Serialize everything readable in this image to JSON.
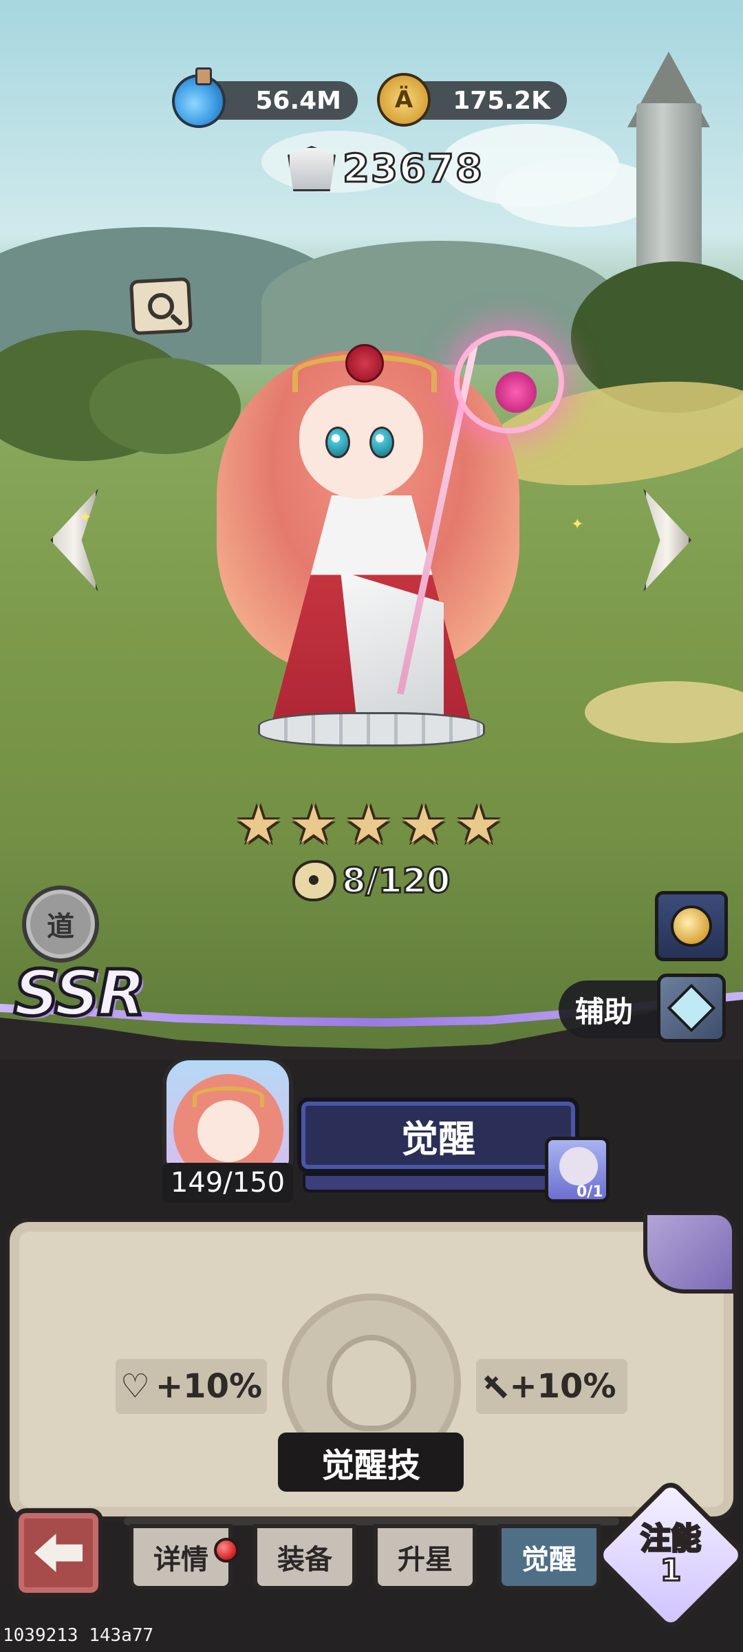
{
  "resources": {
    "potion": {
      "value": "56.4M",
      "icon": "potion-icon"
    },
    "coin": {
      "value": "175.2K",
      "icon": "coin-icon",
      "glyph": "Ä"
    }
  },
  "power": {
    "value": "23678",
    "icon": "power-shield-icon"
  },
  "hero": {
    "stars": 5,
    "star_glyph": "★",
    "shards": "8/120",
    "rarity": "SSR",
    "role": "辅助",
    "dao_label": "道"
  },
  "awaken": {
    "level": "149/150",
    "button_label": "觉醒",
    "requirement_count": "0/1",
    "stat_hp": "+10%",
    "stat_atk": "+10%",
    "skill_label": "觉醒技",
    "heart_glyph": "♡",
    "sword_glyph": "†"
  },
  "tabs": [
    {
      "label": "详情",
      "active": false
    },
    {
      "label": "装备",
      "active": false
    },
    {
      "label": "升星",
      "active": false
    },
    {
      "label": "觉醒",
      "active": true
    }
  ],
  "inject": {
    "label": "注能",
    "count": "1"
  },
  "footer": {
    "id_text": "1039213 143a77"
  },
  "colors": {
    "accent_purple": "#9b79e6",
    "active_tab": "#4f6f86",
    "awaken_button": "#2b2f57",
    "back_button": "#a84b4b"
  }
}
